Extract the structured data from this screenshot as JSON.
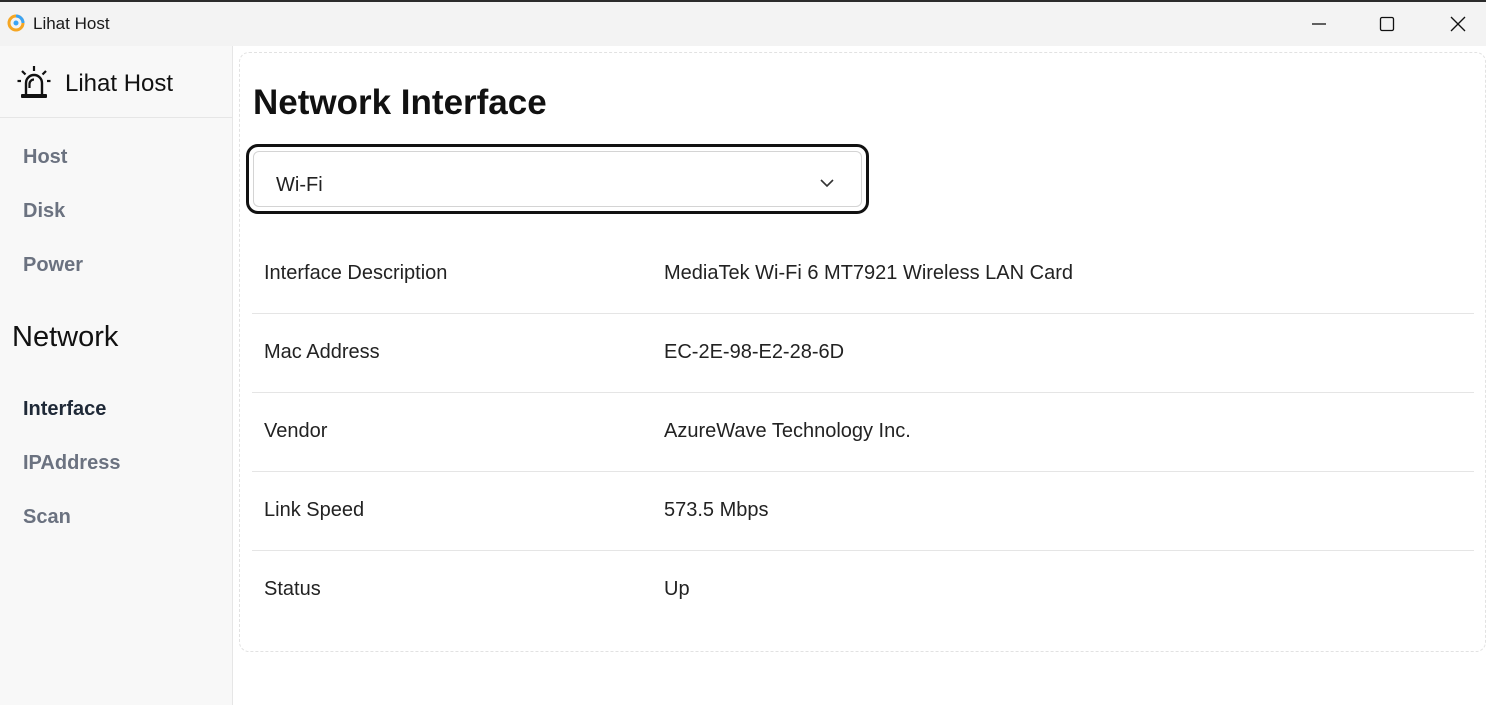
{
  "window": {
    "title": "Lihat Host",
    "icon": "app-logo-icon",
    "controls": [
      "minimize-icon",
      "maximize-icon",
      "close-icon"
    ]
  },
  "sidebar": {
    "brand": {
      "name": "Lihat Host",
      "icon": "alarm-siren-icon"
    },
    "items": [
      {
        "label": "Host"
      },
      {
        "label": "Disk"
      },
      {
        "label": "Power"
      }
    ],
    "section": "Network",
    "network_items": [
      {
        "label": "Interface",
        "active": true
      },
      {
        "label": "IPAddress"
      },
      {
        "label": "Scan"
      }
    ]
  },
  "main": {
    "title": "Network Interface",
    "interface_select": {
      "value": "Wi-Fi",
      "icon": "chevron-down-icon"
    },
    "rows": [
      {
        "key": "Interface Description",
        "value": "MediaTek Wi-Fi 6 MT7921 Wireless LAN Card"
      },
      {
        "key": "Mac Address",
        "value": "EC-2E-98-E2-28-6D"
      },
      {
        "key": "Vendor",
        "value": "AzureWave Technology Inc."
      },
      {
        "key": "Link Speed",
        "value": "573.5 Mbps"
      },
      {
        "key": "Status",
        "value": "Up"
      }
    ]
  },
  "colors": {
    "sidebar_bg": "#f8f8f8",
    "titlebar_bg": "#f3f3f3",
    "nav_inactive": "#6b7280",
    "nav_active": "#1f2937",
    "select_border": "#111111"
  }
}
